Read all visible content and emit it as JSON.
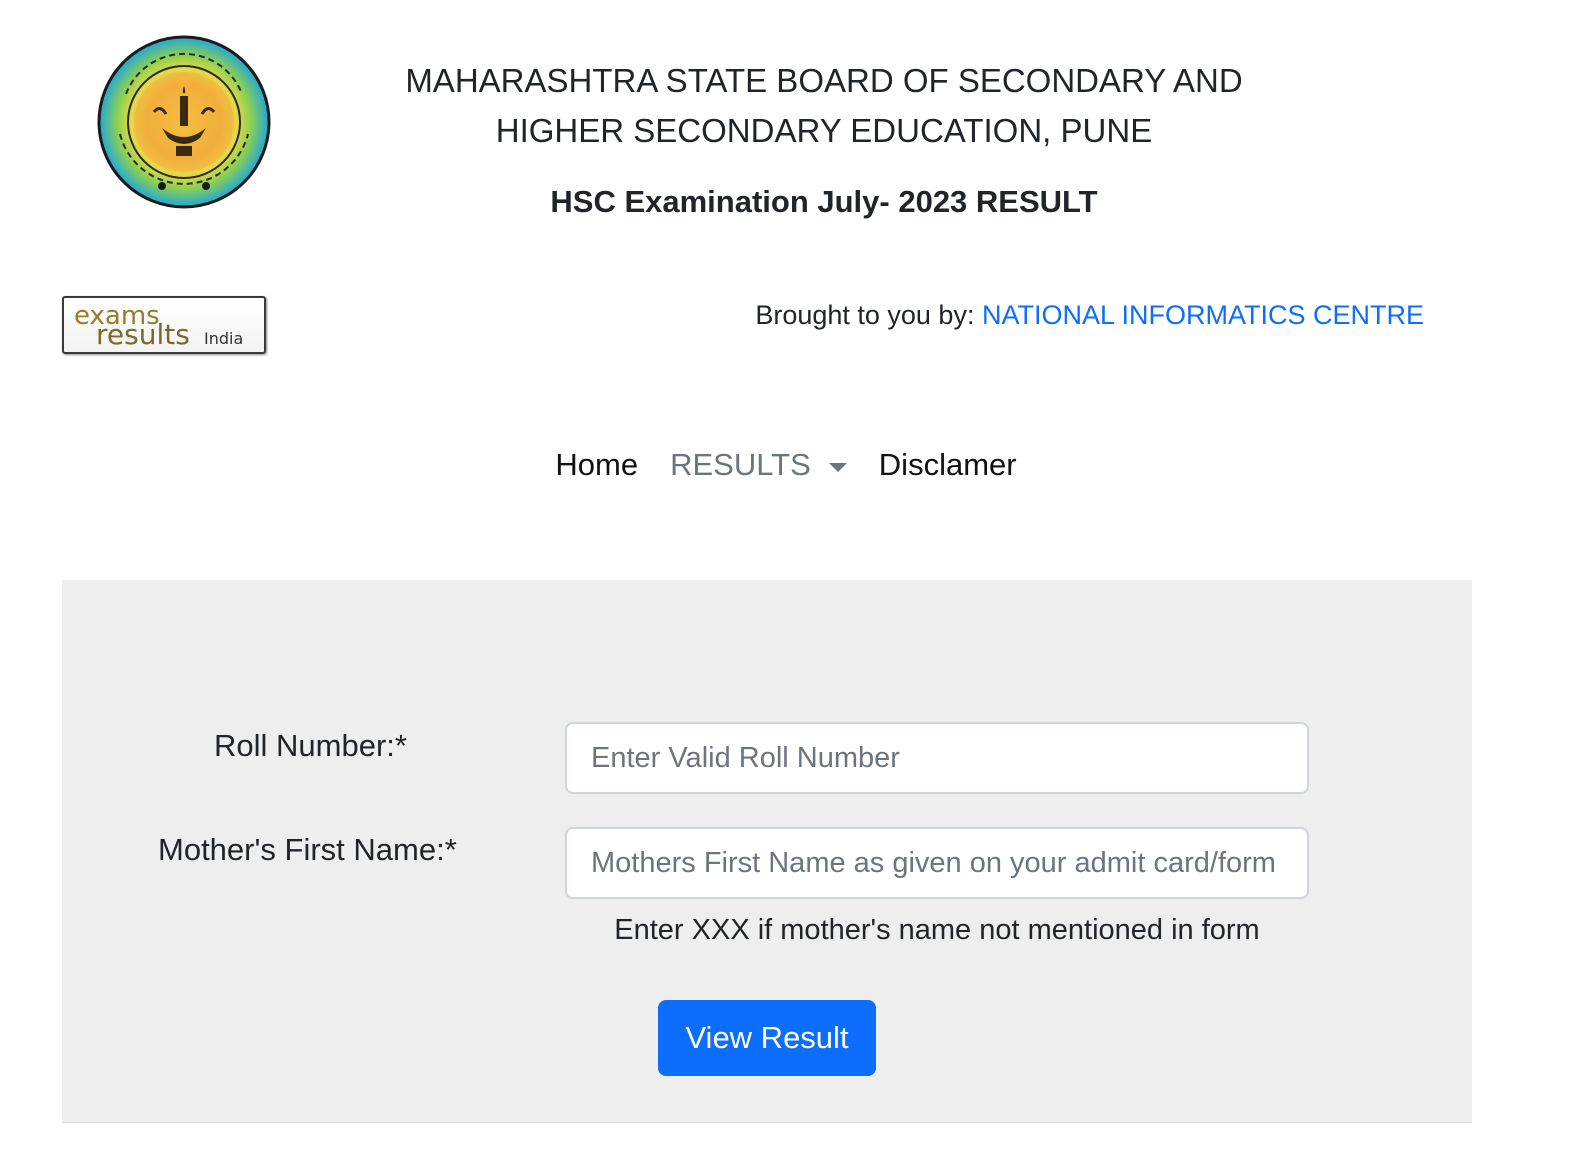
{
  "header": {
    "logo_icon": "msbshse-seal-icon",
    "board_name_line1": "MAHARASHTRA STATE BOARD OF SECONDARY AND",
    "board_name_line2": "HIGHER SECONDARY EDUCATION, PUNE",
    "exam_title": "HSC Examination July- 2023 RESULT"
  },
  "partner": {
    "logo_icon": "exams-results-india-logo-icon",
    "logo_word1": "exams",
    "logo_word2": "results",
    "logo_word3": "India",
    "brought_by_label": "Brought to you by:",
    "brought_by_link": "NATIONAL INFORMATICS CENTRE"
  },
  "nav": {
    "home": "Home",
    "results": "RESULTS",
    "disclaimer": "Disclamer"
  },
  "form": {
    "roll_label": "Roll Number:*",
    "roll_value": "",
    "roll_placeholder": "Enter Valid Roll Number",
    "mother_label": "Mother's First Name:*",
    "mother_value": "",
    "mother_placeholder": "Mothers First Name as given on your admit card/form",
    "mother_help": "Enter XXX if mother's name not mentioned in form",
    "submit_label": "View Result"
  },
  "colors": {
    "link": "#0d6efd",
    "button": "#0d6efd",
    "panel_bg": "#eeeeee",
    "muted_nav": "#6c757d"
  }
}
